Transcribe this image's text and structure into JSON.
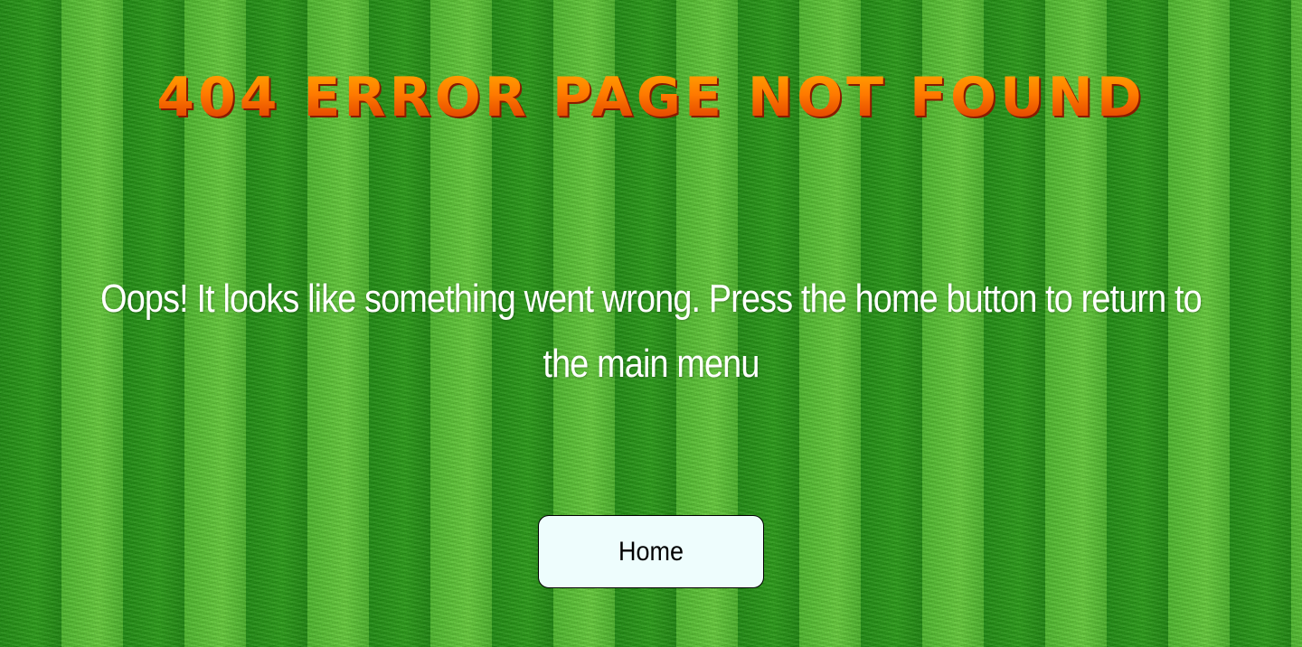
{
  "page": {
    "title": "404 Error Page Not Found",
    "message": "Oops! It looks like something went wrong. Press the home button to return to the main menu",
    "home_button_label": "Home"
  },
  "colors": {
    "title_top": "#ffb000",
    "title_bottom": "#d42a00",
    "message_text": "#ffffff",
    "button_background": "#eefdfd",
    "grass_dark": "#1f8a12",
    "grass_light": "#63c83a"
  }
}
